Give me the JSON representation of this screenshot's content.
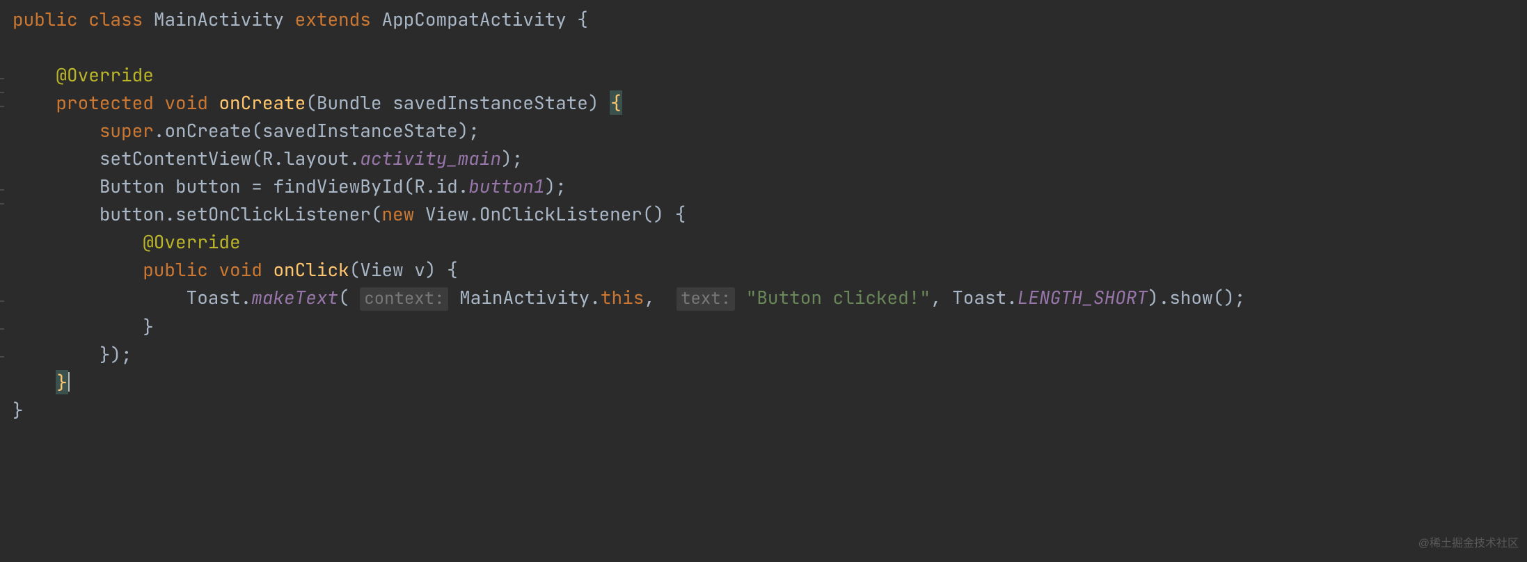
{
  "code": {
    "line1": {
      "public": "public",
      "class": "class",
      "className": "MainActivity",
      "extends": "extends",
      "superClass": "AppCompatActivity",
      "openBrace": "{"
    },
    "line3": {
      "annotation": "@Override"
    },
    "line4": {
      "protected": "protected",
      "void": "void",
      "method": "onCreate",
      "paramType": "Bundle",
      "paramName": "savedInstanceState",
      "openParen": "(",
      "closeParen": ")",
      "openBrace": "{"
    },
    "line5": {
      "super": "super",
      "dot": ".",
      "call": "onCreate",
      "open": "(",
      "arg": "savedInstanceState",
      "close": ");"
    },
    "line6": {
      "call": "setContentView",
      "open": "(",
      "r": "R",
      "dot1": ".",
      "layout": "layout",
      "dot2": ".",
      "res": "activity_main",
      "close": ");"
    },
    "line7": {
      "type": "Button",
      "name": "button",
      "eq": " = ",
      "call": "findViewById",
      "open": "(",
      "r": "R",
      "dot1": ".",
      "id": "id",
      "dot2": ".",
      "res": "button1",
      "close": ");"
    },
    "line8": {
      "obj": "button",
      "dot": ".",
      "call": "setOnClickListener",
      "open": "(",
      "new": "new",
      "type": "View",
      "dot2": ".",
      "inner": "OnClickListener",
      "parens": "()",
      "openBrace": " {"
    },
    "line9": {
      "annotation": "@Override"
    },
    "line10": {
      "public": "public",
      "void": "void",
      "method": "onClick",
      "open": "(",
      "paramType": "View",
      "paramName": "v",
      "close": ")",
      "openBrace": " {"
    },
    "line11": {
      "toast": "Toast",
      "dot": ".",
      "make": "makeText",
      "open": "(",
      "hint1": "context:",
      "ctx": "MainActivity",
      "dot2": ".",
      "this": "this",
      "comma": ",",
      "hint2": "text:",
      "str": "\"Button clicked!\"",
      "comma2": ",",
      "toast2": "Toast",
      "dot3": ".",
      "len": "LENGTH_SHORT",
      "closeMake": ")",
      "dot4": ".",
      "show": "show",
      "showParens": "();"
    },
    "line12": {
      "brace": "}"
    },
    "line13": {
      "braceParen": "});"
    },
    "line14": {
      "brace": "}"
    },
    "line15": {
      "brace": "}"
    }
  },
  "watermark": "@稀土掘金技术社区"
}
